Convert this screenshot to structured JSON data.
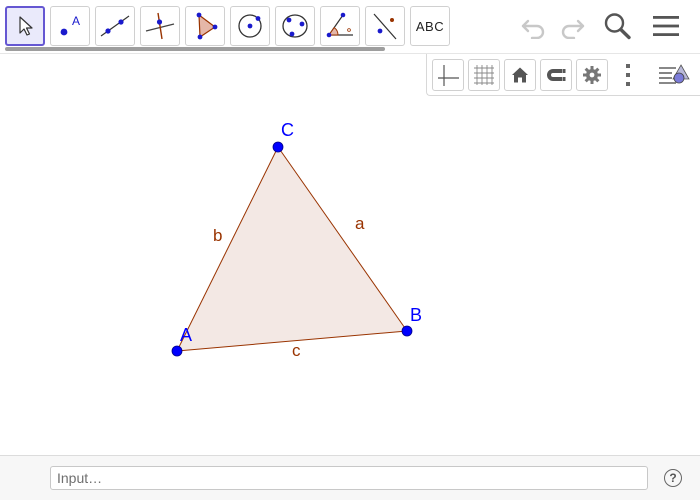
{
  "toolbar": {
    "tools": [
      {
        "name": "move-tool",
        "icon": "cursor-arrow-icon",
        "selected": true
      },
      {
        "name": "point-tool",
        "icon": "point-icon",
        "label": "A"
      },
      {
        "name": "line-tool",
        "icon": "line-through-points-icon"
      },
      {
        "name": "perpendicular-line-tool",
        "icon": "perpendicular-line-icon"
      },
      {
        "name": "polygon-tool",
        "icon": "polygon-icon"
      },
      {
        "name": "circle-center-point-tool",
        "icon": "circle-center-icon"
      },
      {
        "name": "circle-three-points-tool",
        "icon": "circle-three-points-icon"
      },
      {
        "name": "angle-tool",
        "icon": "angle-icon"
      },
      {
        "name": "reflect-about-line-tool",
        "icon": "reflect-line-icon"
      },
      {
        "name": "text-tool",
        "icon": "text-icon",
        "label": "ABC"
      }
    ],
    "right_icons": [
      "undo-icon",
      "redo-icon",
      "search-icon",
      "menu-icon"
    ]
  },
  "stylebar": {
    "buttons": [
      "axes-icon",
      "grid-icon",
      "home-icon",
      "snap-magnet-icon",
      "settings-gear-icon",
      "more-vertical-icon",
      "toggle-style-bar-icon"
    ]
  },
  "graphics": {
    "points": [
      {
        "label": "A"
      },
      {
        "label": "B"
      },
      {
        "label": "C"
      }
    ],
    "segments": [
      {
        "label": "a"
      },
      {
        "label": "b"
      },
      {
        "label": "c"
      }
    ],
    "colors": {
      "point": "#0000ff",
      "point_label": "#0000ff",
      "segment": "#993300",
      "segment_label": "#993300",
      "polygon_fill": "#f3e8e4",
      "accent": "#6557d2"
    }
  },
  "input_bar": {
    "placeholder": "Input…",
    "help_label": "?"
  }
}
